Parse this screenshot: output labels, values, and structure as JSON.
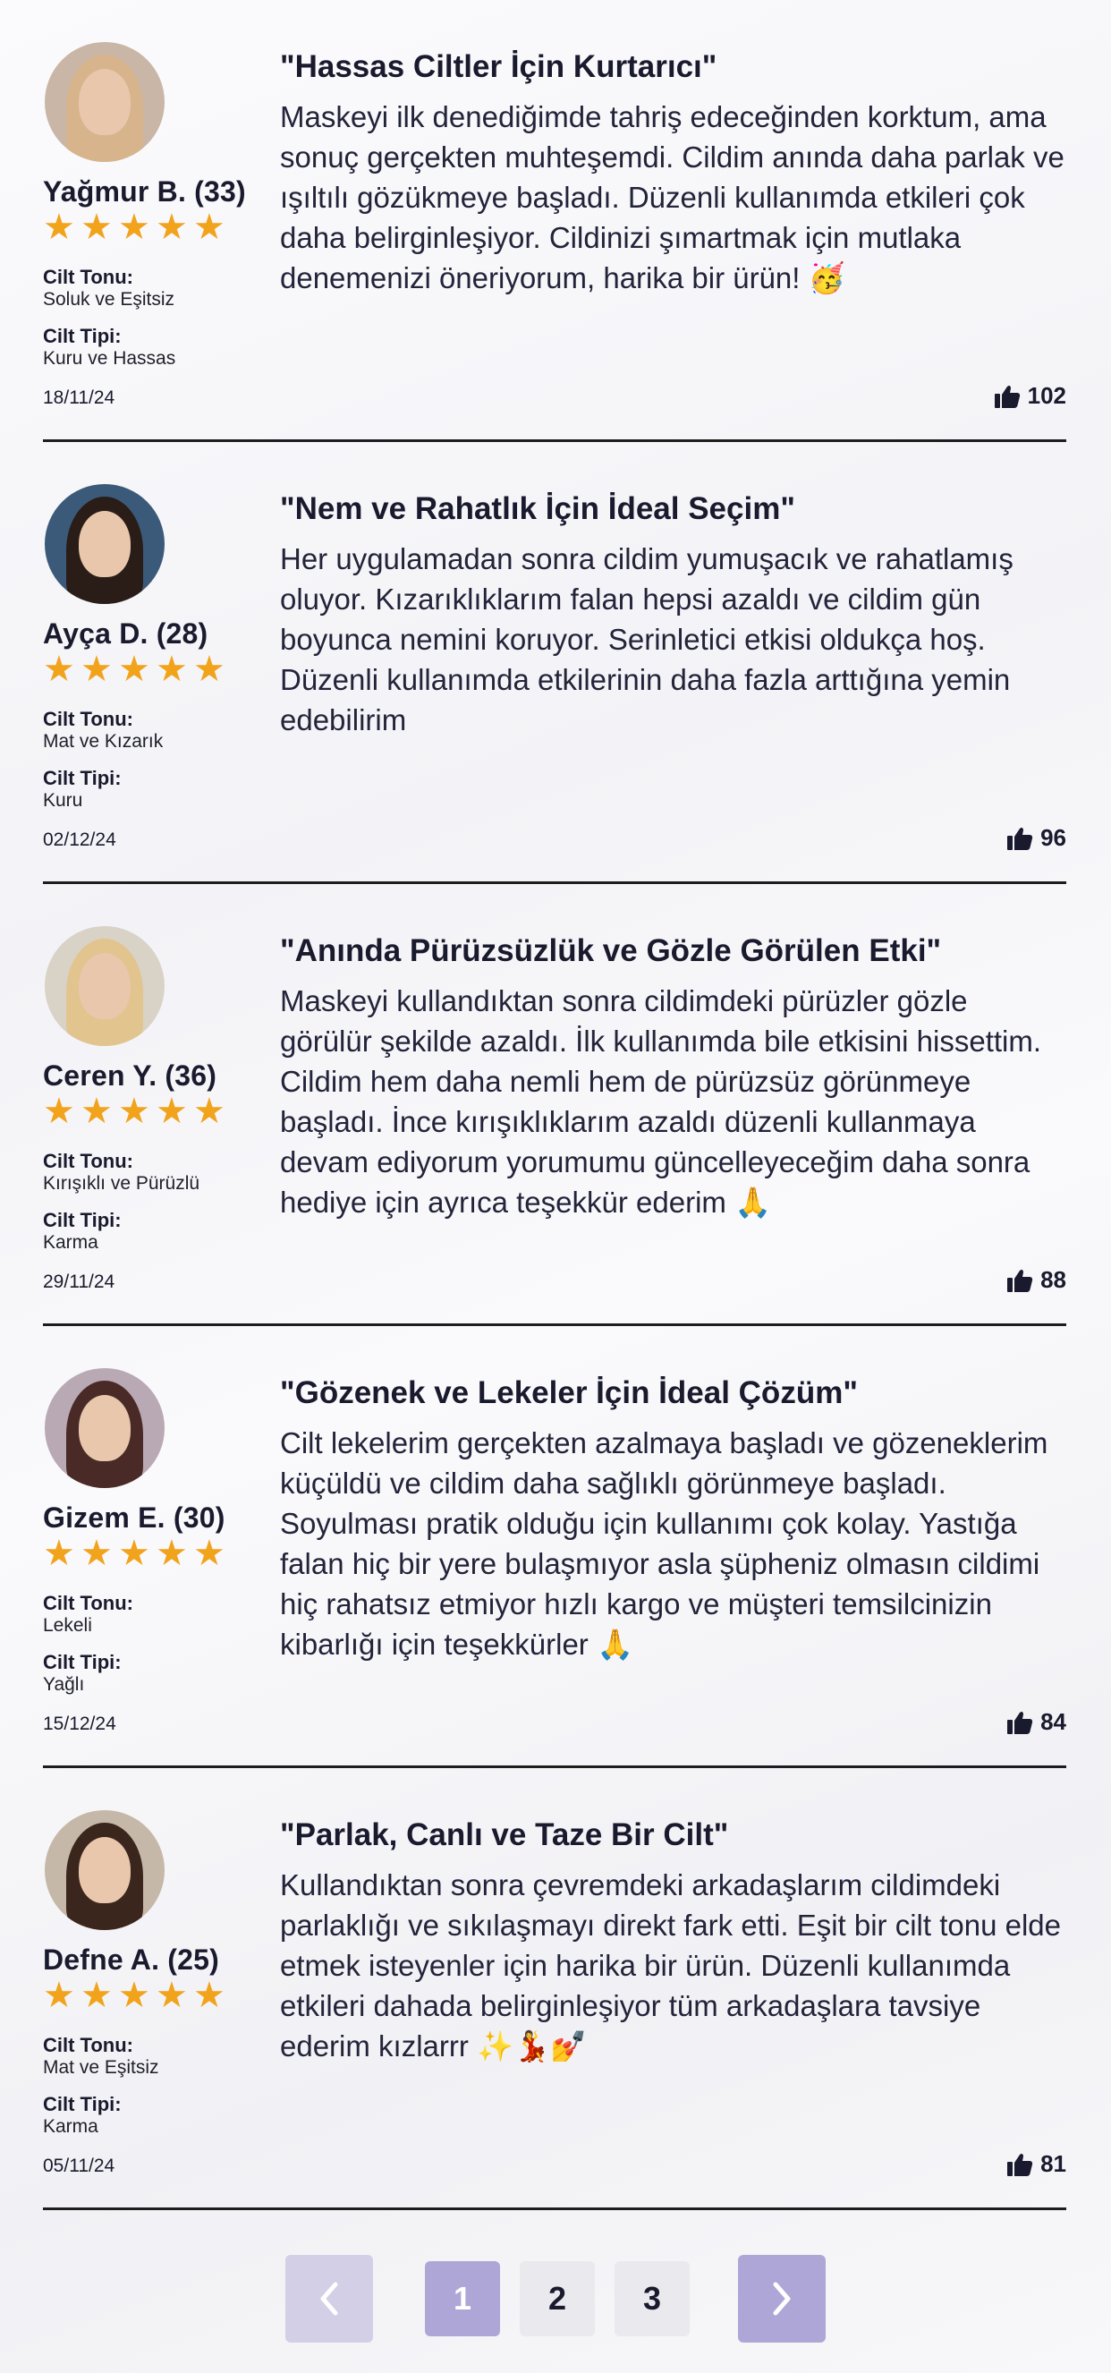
{
  "reviews": [
    {
      "title": "\"Hassas Ciltler İçin Kurtarıcı\"",
      "body": "Maskeyi ilk denediğimde tahriş edeceğinden korktum, ama sonuç gerçekten muhteşemdi. Cildim anında daha parlak ve ışıltılı gözükmeye başladı. Düzenli kullanımda etkileri çok daha belirginleşiyor. Cildinizi şımartmak için mutlaka denemenizi öneriyorum, harika bir ürün! 🥳",
      "name": "Yağmur B. (33)",
      "rating": 5,
      "skin_tone_label": "Cilt Tonu:",
      "skin_tone": "Soluk ve Eşitsiz",
      "skin_type_label": "Cilt Tipi:",
      "skin_type": "Kuru ve Hassas",
      "date": "18/11/24",
      "likes": "102",
      "avatar_bg": "#c9b6a6",
      "avatar_hair": "#d7b48c"
    },
    {
      "title": "\"Nem ve Rahatlık İçin İdeal Seçim\"",
      "body": "Her uygulamadan sonra cildim yumuşacık ve rahatlamış oluyor. Kızarıklıklarım falan hepsi azaldı ve cildim gün boyunca nemini koruyor. Serinletici etkisi oldukça hoş. Düzenli kullanımda etkilerinin daha fazla arttığına yemin edebilirim",
      "name": "Ayça D. (28)",
      "rating": 5,
      "skin_tone_label": "Cilt Tonu:",
      "skin_tone": "Mat ve Kızarık",
      "skin_type_label": "Cilt Tipi:",
      "skin_type": "Kuru",
      "date": "02/12/24",
      "likes": "96",
      "avatar_bg": "#3b5a7a",
      "avatar_hair": "#2a1d17"
    },
    {
      "title": "\"Anında Pürüzsüzlük ve Gözle Görülen Etki\"",
      "body": "Maskeyi kullandıktan sonra cildimdeki pürüzler gözle görülür şekilde azaldı. İlk kullanımda bile etkisini hissettim. Cildim hem daha nemli hem de pürüzsüz görünmeye başladı. İnce kırışıklıklarım azaldı düzenli kullanmaya devam ediyorum yorumumu güncelleyeceğim daha sonra hediye için ayrıca teşekkür ederim 🙏",
      "name": "Ceren Y. (36)",
      "rating": 5,
      "skin_tone_label": "Cilt Tonu:",
      "skin_tone": "Kırışıklı ve Pürüzlü",
      "skin_type_label": "Cilt Tipi:",
      "skin_type": "Karma",
      "date": "29/11/24",
      "likes": "88",
      "avatar_bg": "#d9d2c7",
      "avatar_hair": "#e2c48f"
    },
    {
      "title": "\"Gözenek ve Lekeler İçin İdeal Çözüm\"",
      "body": "Cilt lekelerim gerçekten azalmaya başladı ve gözeneklerim küçüldü ve cildim daha sağlıklı görünmeye başladı. Soyulması pratik olduğu için kullanımı çok kolay. Yastığa falan hiç bir yere bulaşmıyor asla şüpheniz olmasın cildimi hiç rahatsız etmiyor hızlı kargo ve müşteri temsilcinizin kibarlığı için teşekkürler 🙏",
      "name": "Gizem E. (30)",
      "rating": 5,
      "skin_tone_label": "Cilt Tonu:",
      "skin_tone": "Lekeli",
      "skin_type_label": "Cilt Tipi:",
      "skin_type": "Yağlı",
      "date": "15/12/24",
      "likes": "84",
      "avatar_bg": "#b9a9b5",
      "avatar_hair": "#4a2a26"
    },
    {
      "title": "\"Parlak, Canlı ve Taze Bir Cilt\"",
      "body": "Kullandıktan sonra çevremdeki arkadaşlarım cildimdeki parlaklığı ve sıkılaşmayı direkt fark etti. Eşit bir cilt tonu elde etmek isteyenler için harika bir ürün. Düzenli kullanımda etkileri dahada belirginleşiyor tüm arkadaşlara tavsiye ederim kızlarrr ✨💃💅",
      "name": "Defne A. (25)",
      "rating": 5,
      "skin_tone_label": "Cilt Tonu:",
      "skin_tone": "Mat ve Eşitsiz",
      "skin_type_label": "Cilt Tipi:",
      "skin_type": "Karma",
      "date": "05/11/24",
      "likes": "81",
      "avatar_bg": "#c6b8a8",
      "avatar_hair": "#3a261c"
    }
  ],
  "pagination": {
    "prev_icon": "chevron-left-icon",
    "next_icon": "chevron-right-icon",
    "pages": [
      "1",
      "2",
      "3"
    ],
    "current_page": "1",
    "colors": {
      "arrow_disabled": "#d3cfe6",
      "arrow_active": "#aea6d6",
      "page_current": "#aea6d6",
      "page_other": "#e9e9ee"
    }
  },
  "colors": {
    "star": "#f2a31c",
    "divider": "#1d1d1d"
  }
}
